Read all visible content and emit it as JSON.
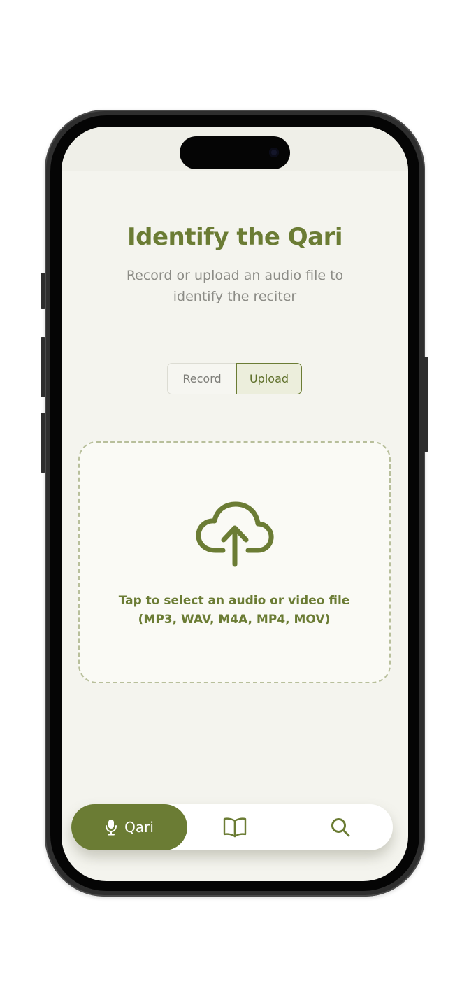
{
  "header": {
    "title": "Identify the Qari",
    "subtitle": "Record or upload an audio file to identify the reciter"
  },
  "mode_toggle": {
    "options": [
      {
        "label": "Record",
        "selected": false
      },
      {
        "label": "Upload",
        "selected": true
      }
    ]
  },
  "upload": {
    "icon": "cloud-upload-icon",
    "prompt": "Tap to select an audio or video file",
    "formats": "(MP3, WAV, M4A, MP4, MOV)"
  },
  "bottom_nav": {
    "items": [
      {
        "label": "Qari",
        "icon": "microphone-icon",
        "active": true
      },
      {
        "label": "",
        "icon": "open-book-icon",
        "active": false
      },
      {
        "label": "",
        "icon": "search-icon",
        "active": false
      }
    ]
  },
  "colors": {
    "accent": "#6b7c34",
    "background": "#f4f4ee",
    "muted_text": "#8c8c86",
    "dashed_border": "#b8bf9b"
  }
}
